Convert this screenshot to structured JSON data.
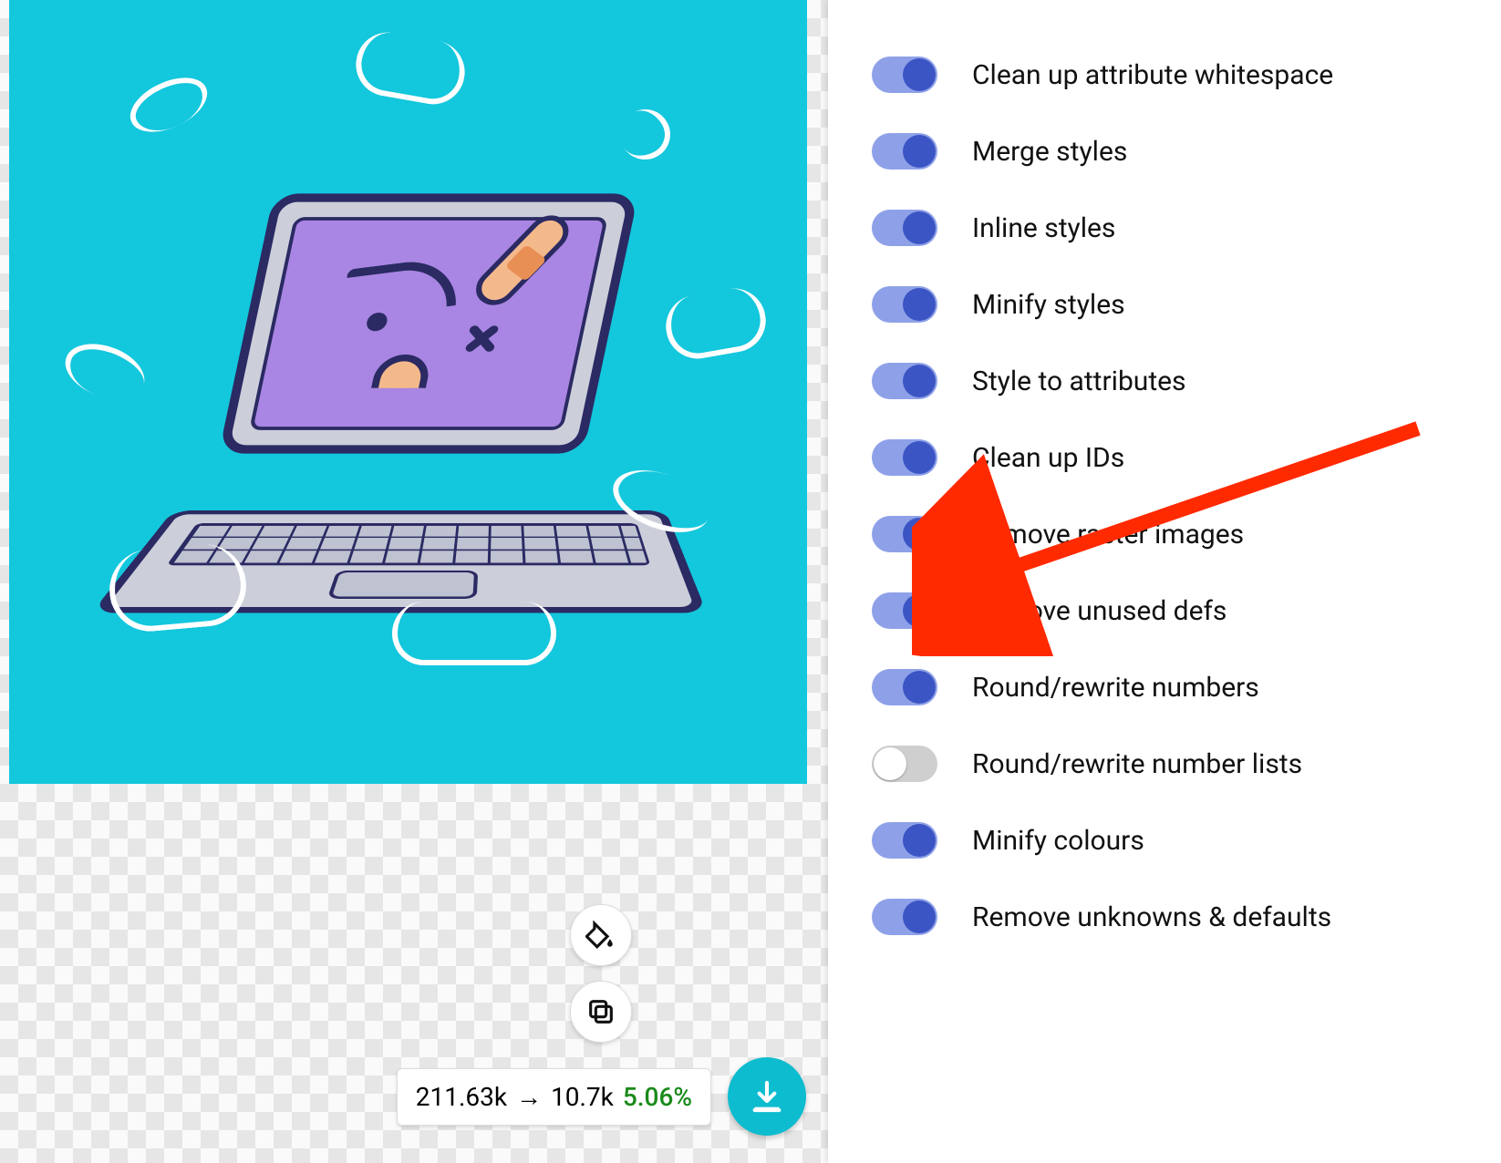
{
  "preview": {
    "accent_color": "#13c7dd",
    "illustration": "sick-laptop-icon"
  },
  "stats": {
    "size_before": "211.63k",
    "arrow": "→",
    "size_after": "10.7k",
    "percent": "5.06%"
  },
  "action_buttons": {
    "fill": "paint-bucket-icon",
    "copy": "copy-icon",
    "download": "download-icon"
  },
  "settings": {
    "options": [
      {
        "id": "clean-attr-ws",
        "label": "Clean up attribute whitespace",
        "enabled": true
      },
      {
        "id": "merge-styles",
        "label": "Merge styles",
        "enabled": true
      },
      {
        "id": "inline-styles",
        "label": "Inline styles",
        "enabled": true
      },
      {
        "id": "minify-styles",
        "label": "Minify styles",
        "enabled": true
      },
      {
        "id": "style-to-attrs",
        "label": "Style to attributes",
        "enabled": true
      },
      {
        "id": "clean-ids",
        "label": "Clean up IDs",
        "enabled": true
      },
      {
        "id": "remove-raster",
        "label": "Remove raster images",
        "enabled": true
      },
      {
        "id": "remove-unused-defs",
        "label": "Remove unused defs",
        "enabled": true
      },
      {
        "id": "round-numbers",
        "label": "Round/rewrite numbers",
        "enabled": true
      },
      {
        "id": "round-number-lists",
        "label": "Round/rewrite number lists",
        "enabled": false
      },
      {
        "id": "minify-colours",
        "label": "Minify colours",
        "enabled": true
      },
      {
        "id": "remove-unknowns",
        "label": "Remove unknowns & defaults",
        "enabled": true
      }
    ]
  },
  "annotation": {
    "target_option": "remove-raster",
    "color": "#ff2a00"
  }
}
